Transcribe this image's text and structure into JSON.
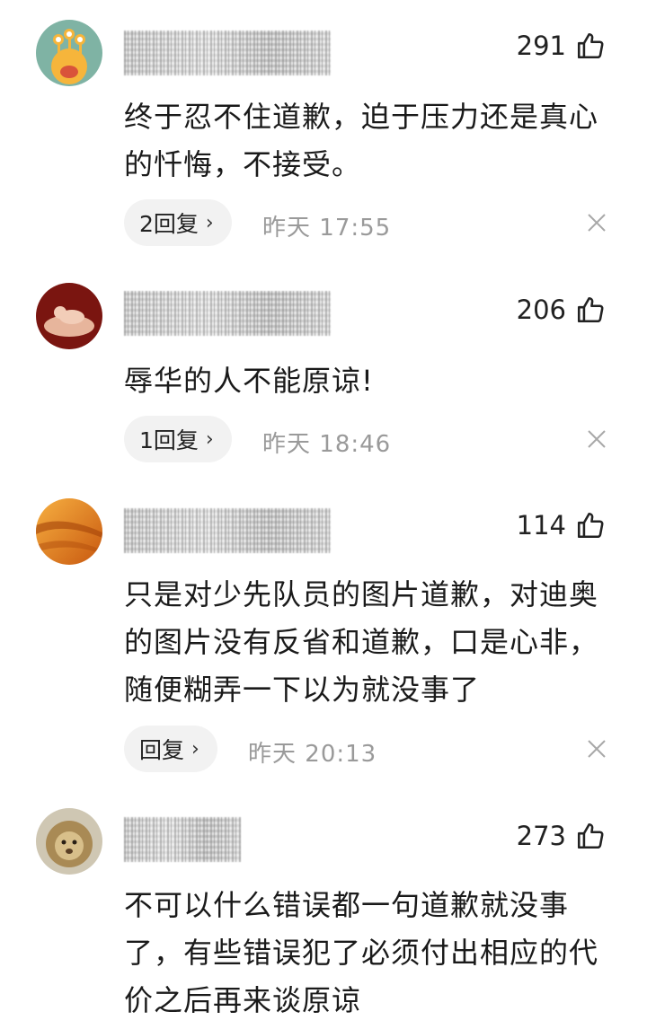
{
  "comments": [
    {
      "likes": "291",
      "text": "终于忍不住道歉，迫于压力还是真心的忏悔，不接受。",
      "reply_label": "2回复",
      "date": "昨天",
      "time": "17:55",
      "avatar": "monster-avatar"
    },
    {
      "likes": "206",
      "text": "辱华的人不能原谅!",
      "reply_label": "1回复",
      "date": "昨天",
      "time": "18:46",
      "avatar": "baby-hands-avatar"
    },
    {
      "likes": "114",
      "text": "只是对少先队员的图片道歉，对迪奥的图片没有反省和道歉，口是心非，随便糊弄一下以为就没事了",
      "reply_label": "回复",
      "date": "昨天",
      "time": "20:13",
      "avatar": "desert-avatar"
    },
    {
      "likes": "273",
      "text": "不可以什么错误都一句道歉就没事了，有些错误犯了必须付出相应的代价之后再来谈原谅",
      "avatar": "lion-avatar"
    }
  ],
  "chevron": "›",
  "colors": {
    "reply_bg": "#f2f2f2",
    "muted": "#9a9a9a",
    "text": "#1a1a1a"
  }
}
